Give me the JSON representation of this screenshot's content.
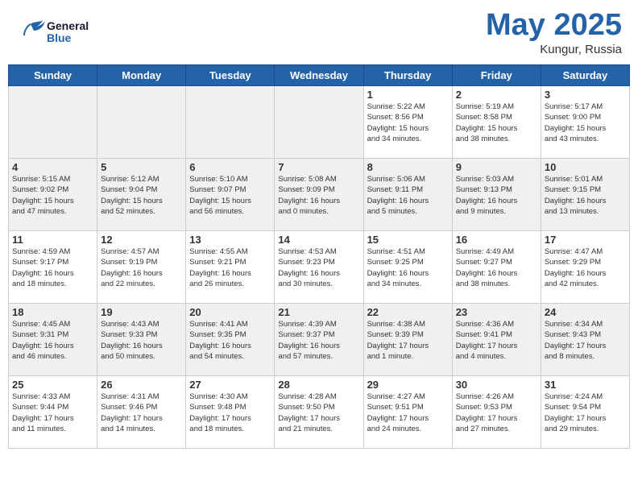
{
  "header": {
    "logo_general": "General",
    "logo_blue": "Blue",
    "month_year": "May 2025",
    "location": "Kungur, Russia"
  },
  "days_of_week": [
    "Sunday",
    "Monday",
    "Tuesday",
    "Wednesday",
    "Thursday",
    "Friday",
    "Saturday"
  ],
  "weeks": [
    {
      "cells": [
        {
          "day": "",
          "info": "",
          "empty": true
        },
        {
          "day": "",
          "info": "",
          "empty": true
        },
        {
          "day": "",
          "info": "",
          "empty": true
        },
        {
          "day": "",
          "info": "",
          "empty": true
        },
        {
          "day": "1",
          "info": "Sunrise: 5:22 AM\nSunset: 8:56 PM\nDaylight: 15 hours\nand 34 minutes."
        },
        {
          "day": "2",
          "info": "Sunrise: 5:19 AM\nSunset: 8:58 PM\nDaylight: 15 hours\nand 38 minutes."
        },
        {
          "day": "3",
          "info": "Sunrise: 5:17 AM\nSunset: 9:00 PM\nDaylight: 15 hours\nand 43 minutes."
        }
      ]
    },
    {
      "cells": [
        {
          "day": "4",
          "info": "Sunrise: 5:15 AM\nSunset: 9:02 PM\nDaylight: 15 hours\nand 47 minutes."
        },
        {
          "day": "5",
          "info": "Sunrise: 5:12 AM\nSunset: 9:04 PM\nDaylight: 15 hours\nand 52 minutes."
        },
        {
          "day": "6",
          "info": "Sunrise: 5:10 AM\nSunset: 9:07 PM\nDaylight: 15 hours\nand 56 minutes."
        },
        {
          "day": "7",
          "info": "Sunrise: 5:08 AM\nSunset: 9:09 PM\nDaylight: 16 hours\nand 0 minutes."
        },
        {
          "day": "8",
          "info": "Sunrise: 5:06 AM\nSunset: 9:11 PM\nDaylight: 16 hours\nand 5 minutes."
        },
        {
          "day": "9",
          "info": "Sunrise: 5:03 AM\nSunset: 9:13 PM\nDaylight: 16 hours\nand 9 minutes."
        },
        {
          "day": "10",
          "info": "Sunrise: 5:01 AM\nSunset: 9:15 PM\nDaylight: 16 hours\nand 13 minutes."
        }
      ]
    },
    {
      "cells": [
        {
          "day": "11",
          "info": "Sunrise: 4:59 AM\nSunset: 9:17 PM\nDaylight: 16 hours\nand 18 minutes."
        },
        {
          "day": "12",
          "info": "Sunrise: 4:57 AM\nSunset: 9:19 PM\nDaylight: 16 hours\nand 22 minutes."
        },
        {
          "day": "13",
          "info": "Sunrise: 4:55 AM\nSunset: 9:21 PM\nDaylight: 16 hours\nand 26 minutes."
        },
        {
          "day": "14",
          "info": "Sunrise: 4:53 AM\nSunset: 9:23 PM\nDaylight: 16 hours\nand 30 minutes."
        },
        {
          "day": "15",
          "info": "Sunrise: 4:51 AM\nSunset: 9:25 PM\nDaylight: 16 hours\nand 34 minutes."
        },
        {
          "day": "16",
          "info": "Sunrise: 4:49 AM\nSunset: 9:27 PM\nDaylight: 16 hours\nand 38 minutes."
        },
        {
          "day": "17",
          "info": "Sunrise: 4:47 AM\nSunset: 9:29 PM\nDaylight: 16 hours\nand 42 minutes."
        }
      ]
    },
    {
      "cells": [
        {
          "day": "18",
          "info": "Sunrise: 4:45 AM\nSunset: 9:31 PM\nDaylight: 16 hours\nand 46 minutes."
        },
        {
          "day": "19",
          "info": "Sunrise: 4:43 AM\nSunset: 9:33 PM\nDaylight: 16 hours\nand 50 minutes."
        },
        {
          "day": "20",
          "info": "Sunrise: 4:41 AM\nSunset: 9:35 PM\nDaylight: 16 hours\nand 54 minutes."
        },
        {
          "day": "21",
          "info": "Sunrise: 4:39 AM\nSunset: 9:37 PM\nDaylight: 16 hours\nand 57 minutes."
        },
        {
          "day": "22",
          "info": "Sunrise: 4:38 AM\nSunset: 9:39 PM\nDaylight: 17 hours\nand 1 minute."
        },
        {
          "day": "23",
          "info": "Sunrise: 4:36 AM\nSunset: 9:41 PM\nDaylight: 17 hours\nand 4 minutes."
        },
        {
          "day": "24",
          "info": "Sunrise: 4:34 AM\nSunset: 9:43 PM\nDaylight: 17 hours\nand 8 minutes."
        }
      ]
    },
    {
      "cells": [
        {
          "day": "25",
          "info": "Sunrise: 4:33 AM\nSunset: 9:44 PM\nDaylight: 17 hours\nand 11 minutes."
        },
        {
          "day": "26",
          "info": "Sunrise: 4:31 AM\nSunset: 9:46 PM\nDaylight: 17 hours\nand 14 minutes."
        },
        {
          "day": "27",
          "info": "Sunrise: 4:30 AM\nSunset: 9:48 PM\nDaylight: 17 hours\nand 18 minutes."
        },
        {
          "day": "28",
          "info": "Sunrise: 4:28 AM\nSunset: 9:50 PM\nDaylight: 17 hours\nand 21 minutes."
        },
        {
          "day": "29",
          "info": "Sunrise: 4:27 AM\nSunset: 9:51 PM\nDaylight: 17 hours\nand 24 minutes."
        },
        {
          "day": "30",
          "info": "Sunrise: 4:26 AM\nSunset: 9:53 PM\nDaylight: 17 hours\nand 27 minutes."
        },
        {
          "day": "31",
          "info": "Sunrise: 4:24 AM\nSunset: 9:54 PM\nDaylight: 17 hours\nand 29 minutes."
        }
      ]
    }
  ]
}
